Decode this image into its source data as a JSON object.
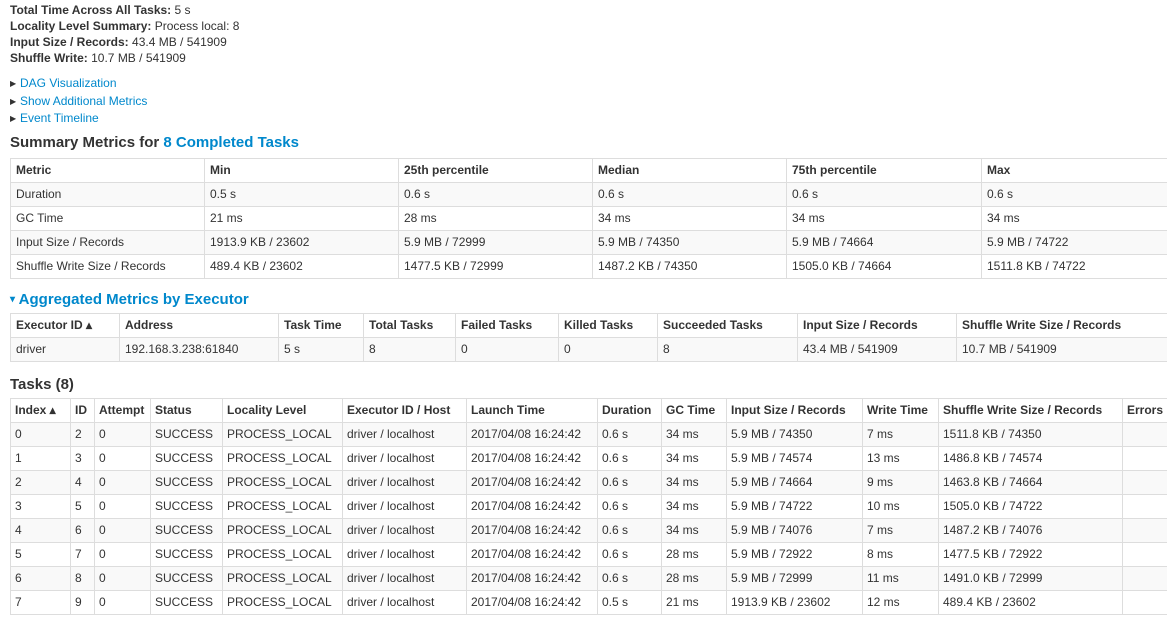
{
  "stats": [
    {
      "label": "Total Time Across All Tasks:",
      "value": "5 s"
    },
    {
      "label": "Locality Level Summary:",
      "value": "Process local: 8"
    },
    {
      "label": "Input Size / Records:",
      "value": "43.4 MB / 541909"
    },
    {
      "label": "Shuffle Write:",
      "value": "10.7 MB / 541909"
    }
  ],
  "links": {
    "dag": "DAG Visualization",
    "metrics": "Show Additional Metrics",
    "timeline": "Event Timeline"
  },
  "summary": {
    "title_prefix": "Summary Metrics for",
    "title_link": "8 Completed Tasks",
    "headers": [
      "Metric",
      "Min",
      "25th percentile",
      "Median",
      "75th percentile",
      "Max"
    ],
    "rows": [
      [
        "Duration",
        "0.5 s",
        "0.6 s",
        "0.6 s",
        "0.6 s",
        "0.6 s"
      ],
      [
        "GC Time",
        "21 ms",
        "28 ms",
        "34 ms",
        "34 ms",
        "34 ms"
      ],
      [
        "Input Size / Records",
        "1913.9 KB / 23602",
        "5.9 MB / 72999",
        "5.9 MB / 74350",
        "5.9 MB / 74664",
        "5.9 MB / 74722"
      ],
      [
        "Shuffle Write Size / Records",
        "489.4 KB / 23602",
        "1477.5 KB / 72999",
        "1487.2 KB / 74350",
        "1505.0 KB / 74664",
        "1511.8 KB / 74722"
      ]
    ]
  },
  "aggregated": {
    "caret": "▾",
    "title": "Aggregated Metrics by Executor",
    "headers": [
      "Executor ID ▴",
      "Address",
      "Task Time",
      "Total Tasks",
      "Failed Tasks",
      "Killed Tasks",
      "Succeeded Tasks",
      "Input Size / Records",
      "Shuffle Write Size / Records"
    ],
    "rows": [
      [
        "driver",
        "192.168.3.238:61840",
        "5 s",
        "8",
        "0",
        "0",
        "8",
        "43.4 MB / 541909",
        "10.7 MB / 541909"
      ]
    ]
  },
  "tasks": {
    "title": "Tasks (8)",
    "headers": [
      "Index ▴",
      "ID",
      "Attempt",
      "Status",
      "Locality Level",
      "Executor ID / Host",
      "Launch Time",
      "Duration",
      "GC Time",
      "Input Size / Records",
      "Write Time",
      "Shuffle Write Size / Records",
      "Errors"
    ],
    "rows": [
      [
        "0",
        "2",
        "0",
        "SUCCESS",
        "PROCESS_LOCAL",
        "driver / localhost",
        "2017/04/08 16:24:42",
        "0.6 s",
        "34 ms",
        "5.9 MB / 74350",
        "7 ms",
        "1511.8 KB / 74350",
        ""
      ],
      [
        "1",
        "3",
        "0",
        "SUCCESS",
        "PROCESS_LOCAL",
        "driver / localhost",
        "2017/04/08 16:24:42",
        "0.6 s",
        "34 ms",
        "5.9 MB / 74574",
        "13 ms",
        "1486.8 KB / 74574",
        ""
      ],
      [
        "2",
        "4",
        "0",
        "SUCCESS",
        "PROCESS_LOCAL",
        "driver / localhost",
        "2017/04/08 16:24:42",
        "0.6 s",
        "34 ms",
        "5.9 MB / 74664",
        "9 ms",
        "1463.8 KB / 74664",
        ""
      ],
      [
        "3",
        "5",
        "0",
        "SUCCESS",
        "PROCESS_LOCAL",
        "driver / localhost",
        "2017/04/08 16:24:42",
        "0.6 s",
        "34 ms",
        "5.9 MB / 74722",
        "10 ms",
        "1505.0 KB / 74722",
        ""
      ],
      [
        "4",
        "6",
        "0",
        "SUCCESS",
        "PROCESS_LOCAL",
        "driver / localhost",
        "2017/04/08 16:24:42",
        "0.6 s",
        "34 ms",
        "5.9 MB / 74076",
        "7 ms",
        "1487.2 KB / 74076",
        ""
      ],
      [
        "5",
        "7",
        "0",
        "SUCCESS",
        "PROCESS_LOCAL",
        "driver / localhost",
        "2017/04/08 16:24:42",
        "0.6 s",
        "28 ms",
        "5.9 MB / 72922",
        "8 ms",
        "1477.5 KB / 72922",
        ""
      ],
      [
        "6",
        "8",
        "0",
        "SUCCESS",
        "PROCESS_LOCAL",
        "driver / localhost",
        "2017/04/08 16:24:42",
        "0.6 s",
        "28 ms",
        "5.9 MB / 72999",
        "11 ms",
        "1491.0 KB / 72999",
        ""
      ],
      [
        "7",
        "9",
        "0",
        "SUCCESS",
        "PROCESS_LOCAL",
        "driver / localhost",
        "2017/04/08 16:24:42",
        "0.5 s",
        "21 ms",
        "1913.9 KB / 23602",
        "12 ms",
        "489.4 KB / 23602",
        ""
      ]
    ]
  }
}
